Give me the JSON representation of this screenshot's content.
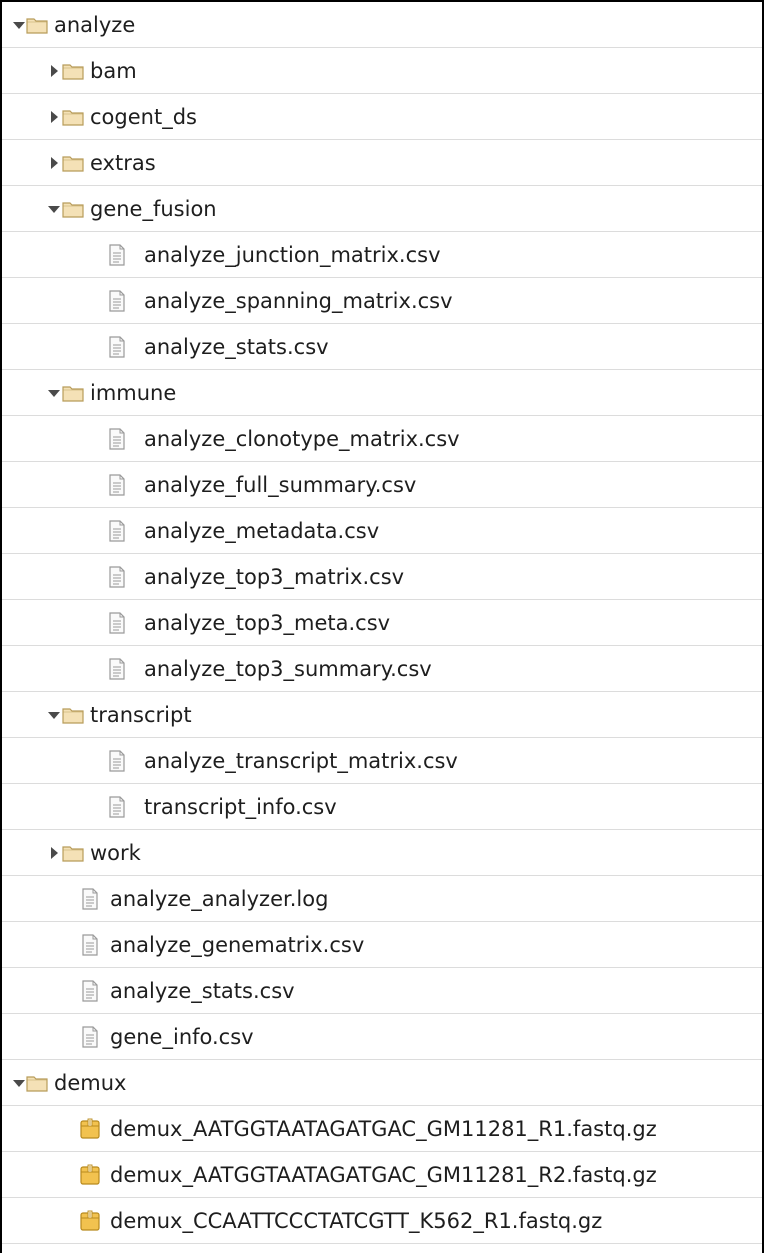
{
  "tree": [
    {
      "label": "analyze",
      "type": "folder",
      "expanded": true,
      "level": 0
    },
    {
      "label": "bam",
      "type": "folder",
      "expanded": false,
      "level": 1
    },
    {
      "label": "cogent_ds",
      "type": "folder",
      "expanded": false,
      "level": 1
    },
    {
      "label": "extras",
      "type": "folder",
      "expanded": false,
      "level": 1
    },
    {
      "label": "gene_fusion",
      "type": "folder",
      "expanded": true,
      "level": 1
    },
    {
      "label": "analyze_junction_matrix.csv",
      "type": "file",
      "level": 2
    },
    {
      "label": "analyze_spanning_matrix.csv",
      "type": "file",
      "level": 2
    },
    {
      "label": "analyze_stats.csv",
      "type": "file",
      "level": 2
    },
    {
      "label": "immune",
      "type": "folder",
      "expanded": true,
      "level": 1
    },
    {
      "label": "analyze_clonotype_matrix.csv",
      "type": "file",
      "level": 2
    },
    {
      "label": "analyze_full_summary.csv",
      "type": "file",
      "level": 2
    },
    {
      "label": "analyze_metadata.csv",
      "type": "file",
      "level": 2
    },
    {
      "label": "analyze_top3_matrix.csv",
      "type": "file",
      "level": 2
    },
    {
      "label": "analyze_top3_meta.csv",
      "type": "file",
      "level": 2
    },
    {
      "label": "analyze_top3_summary.csv",
      "type": "file",
      "level": 2
    },
    {
      "label": "transcript",
      "type": "folder",
      "expanded": true,
      "level": 1
    },
    {
      "label": "analyze_transcript_matrix.csv",
      "type": "file",
      "level": 2
    },
    {
      "label": "transcript_info.csv",
      "type": "file",
      "level": 2
    },
    {
      "label": "work",
      "type": "folder",
      "expanded": false,
      "level": 1
    },
    {
      "label": "analyze_analyzer.log",
      "type": "file",
      "level": 1
    },
    {
      "label": "analyze_genematrix.csv",
      "type": "file",
      "level": 1
    },
    {
      "label": "analyze_stats.csv",
      "type": "file",
      "level": 1
    },
    {
      "label": "gene_info.csv",
      "type": "file",
      "level": 1
    },
    {
      "label": "demux",
      "type": "folder",
      "expanded": true,
      "level": 0
    },
    {
      "label": "demux_AATGGTAATAGATGAC_GM11281_R1.fastq.gz",
      "type": "archive",
      "level": 1
    },
    {
      "label": "demux_AATGGTAATAGATGAC_GM11281_R2.fastq.gz",
      "type": "archive",
      "level": 1
    },
    {
      "label": "demux_CCAATTCCCTATCGTT_K562_R1.fastq.gz",
      "type": "archive",
      "level": 1
    }
  ],
  "colors": {
    "folder_fill": "#f4e1b6",
    "folder_stroke": "#b89c5a",
    "file_fill": "#fafafa",
    "file_stroke": "#9a9a9a",
    "archive_fill": "#f2c24f",
    "archive_stroke": "#b88a1e",
    "toggle": "#4a4a4a",
    "text": "#1e1e1e",
    "row_divider": "#dcdcdc"
  },
  "icons": {
    "folder": "folder-icon",
    "file": "file-icon",
    "archive": "archive-icon",
    "expanded": "triangle-down-icon",
    "collapsed": "triangle-right-icon"
  }
}
